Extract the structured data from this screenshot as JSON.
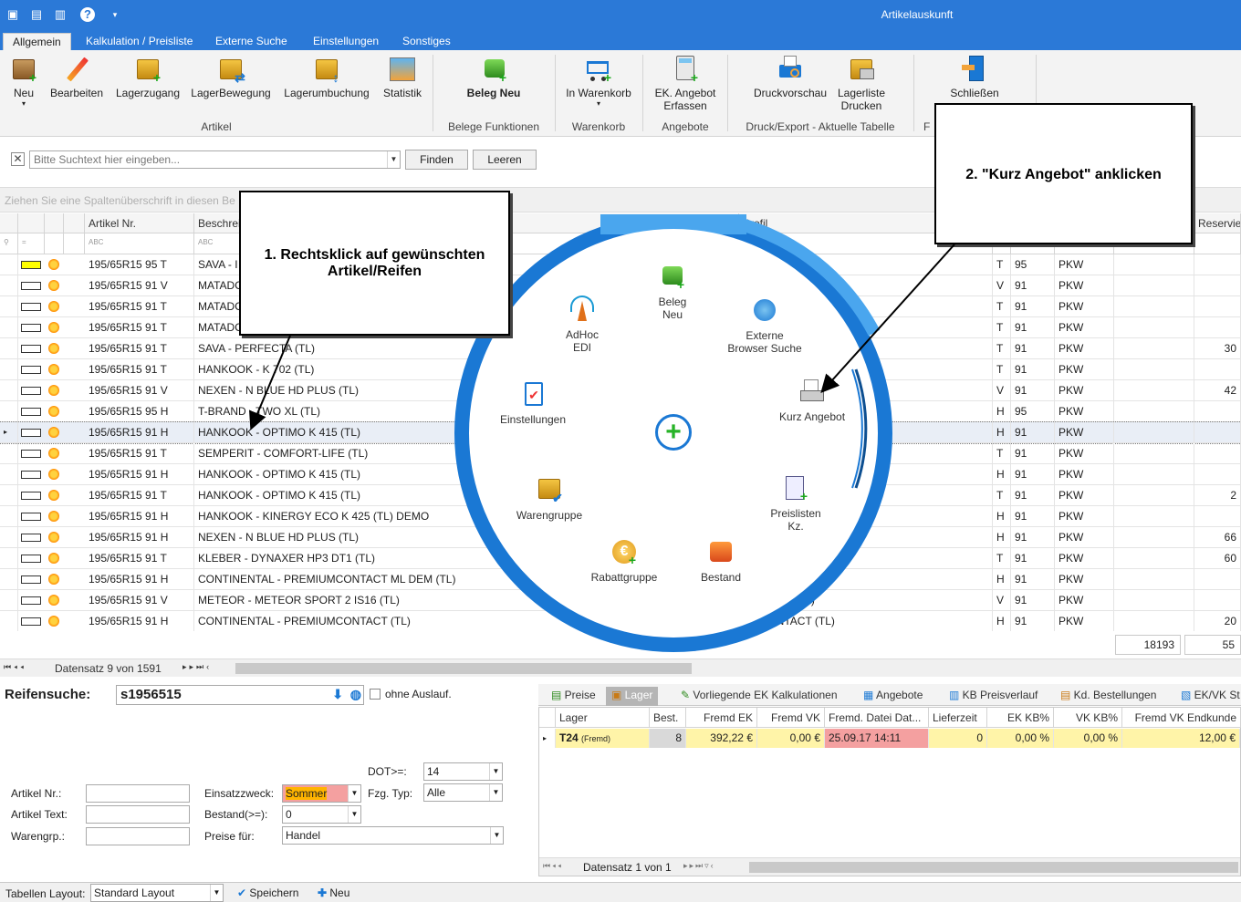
{
  "window": {
    "title": "Artikelauskunft"
  },
  "tabs": [
    "Allgemein",
    "Kalkulation / Preisliste",
    "Externe Suche",
    "Einstellungen",
    "Sonstiges"
  ],
  "ribbon": {
    "buttons": [
      "Neu",
      "Bearbeiten",
      "Lagerzugang",
      "LagerBewegung",
      "Lagerumbuchung",
      "Statistik",
      "Beleg Neu",
      "In Warenkorb",
      "EK. Angebot",
      "Erfassen",
      "Druckvorschau",
      "Lagerliste",
      "Drucken",
      "Schließen"
    ],
    "groups": [
      "Artikel",
      "Belege Funktionen",
      "Warenkorb",
      "Angebote",
      "Druck/Export - Aktuelle Tabelle",
      "F"
    ]
  },
  "search": {
    "placeholder": "Bitte Suchtext hier eingeben...",
    "find_label": "Finden",
    "clear_label": "Leeren"
  },
  "group_panel_text": "Ziehen Sie eine Spaltenüberschrift in diesen Be",
  "grid": {
    "columns": [
      "Artikel Nr.",
      "Beschrei",
      "Profil",
      "Reservier"
    ],
    "rows": [
      {
        "nr": "195/65R15 95 T",
        "desc": "SAVA - I",
        "profil": "(TL)",
        "si": "T",
        "li": "95",
        "typ": "PKW",
        "res": "",
        "yellow": true
      },
      {
        "nr": "195/65R15 91 V",
        "desc": "MATADO",
        "profil": "",
        "si": "V",
        "li": "91",
        "typ": "PKW",
        "res": ""
      },
      {
        "nr": "195/65R15 91 T",
        "desc": "MATADO",
        "profil": "",
        "si": "T",
        "li": "91",
        "typ": "PKW",
        "res": ""
      },
      {
        "nr": "195/65R15 91 T",
        "desc": "MATADO",
        "profil": "",
        "si": "T",
        "li": "91",
        "typ": "PKW",
        "res": ""
      },
      {
        "nr": "195/65R15 91 T",
        "desc": "SAVA - PERFECTA (TL)",
        "profil": "",
        "si": "T",
        "li": "91",
        "typ": "PKW",
        "res": "30"
      },
      {
        "nr": "195/65R15 91 T",
        "desc": "HANKOOK - K 702 (TL)",
        "profil": "",
        "si": "T",
        "li": "91",
        "typ": "PKW",
        "res": ""
      },
      {
        "nr": "195/65R15 91 V",
        "desc": "NEXEN - N BLUE HD PLUS (TL)",
        "profil": "",
        "si": "V",
        "li": "91",
        "typ": "PKW",
        "res": "42"
      },
      {
        "nr": "195/65R15 95 H",
        "desc": "T-BRAND - TWO XL (TL)",
        "profil": "",
        "si": "H",
        "li": "95",
        "typ": "PKW",
        "res": ""
      },
      {
        "nr": "195/65R15 91 H",
        "desc": "HANKOOK - OPTIMO K 415 (TL)",
        "profil": "",
        "si": "H",
        "li": "91",
        "typ": "PKW",
        "res": "",
        "selected": true
      },
      {
        "nr": "195/65R15 91 T",
        "desc": "SEMPERIT - COMFORT-LIFE (TL)",
        "profil": "",
        "si": "T",
        "li": "91",
        "typ": "PKW",
        "res": ""
      },
      {
        "nr": "195/65R15 91 H",
        "desc": "HANKOOK - OPTIMO K 415 (TL)",
        "profil": "",
        "si": "H",
        "li": "91",
        "typ": "PKW",
        "res": ""
      },
      {
        "nr": "195/65R15 91 T",
        "desc": "HANKOOK - OPTIMO K 415 (TL)",
        "profil": "",
        "si": "T",
        "li": "91",
        "typ": "PKW",
        "res": "2"
      },
      {
        "nr": "195/65R15 91 H",
        "desc": "HANKOOK - KINERGY ECO K 425 (TL) DEMO",
        "profil": "DEMO",
        "si": "H",
        "li": "91",
        "typ": "PKW",
        "res": ""
      },
      {
        "nr": "195/65R15 91 H",
        "desc": "NEXEN - N BLUE HD PLUS (TL)",
        "profil": "",
        "si": "H",
        "li": "91",
        "typ": "PKW",
        "res": "66"
      },
      {
        "nr": "195/65R15 91 T",
        "desc": "KLEBER - DYNAXER HP3 DT1 (TL)",
        "profil": "(TL)",
        "si": "T",
        "li": "91",
        "typ": "PKW",
        "res": "60"
      },
      {
        "nr": "195/65R15 91 H",
        "desc": "CONTINENTAL - PREMIUMCONTACT ML DEM (TL)",
        "profil": "T ML DEM (TL)",
        "si": "H",
        "li": "91",
        "typ": "PKW",
        "res": ""
      },
      {
        "nr": "195/65R15 91 V",
        "desc": "METEOR - METEOR SPORT 2 IS16 (TL)",
        "profil": "RT 2 IS16 (TL)",
        "si": "V",
        "li": "91",
        "typ": "PKW",
        "res": ""
      },
      {
        "nr": "195/65R15 91 H",
        "desc": "CONTINENTAL - PREMIUMCONTACT (TL)",
        "profil": "UMCONTACT (TL)",
        "si": "H",
        "li": "91",
        "typ": "PKW",
        "res": "20"
      }
    ],
    "sum1": "18193",
    "sum2": "55"
  },
  "navbar": {
    "text": "Datensatz 9 von 1591"
  },
  "radial_menu": {
    "items": [
      "Beleg Neu",
      "Externe Browser Suche",
      "Kurz Angebot",
      "Preislisten Kz.",
      "Bestand",
      "Rabattgruppe",
      "Warengruppe",
      "Einstellungen",
      "AdHoc EDI"
    ]
  },
  "callouts": {
    "step1": "1. Rechtsklick auf gewünschten Artikel/Reifen",
    "step2": "2. \"Kurz Angebot\" anklicken"
  },
  "reifensuche": {
    "label": "Reifensuche:",
    "value": "s1956515",
    "ohne_auslauf": "ohne Auslauf.",
    "dot_label": "DOT>=:",
    "dot_value": "14",
    "artikel_nr_label": "Artikel Nr.:",
    "artikel_text_label": "Artikel Text:",
    "warengrp_label": "Warengrp.:",
    "einsatzzweck_label": "Einsatzzweck:",
    "einsatzzweck_value": "Sommer",
    "bestand_label": "Bestand(>=):",
    "bestand_value": "0",
    "preise_label": "Preise für:",
    "preise_value": "Handel",
    "fzg_label": "Fzg. Typ:",
    "fzg_value": "Alle"
  },
  "detail_tabs": [
    "Preise",
    "Lager",
    "Vorliegende EK Kalkulationen",
    "Angebote",
    "KB Preisverlauf",
    "Kd. Bestellungen",
    "EK/VK St"
  ],
  "lager": {
    "columns": [
      "Lager",
      "Best.",
      "Fremd EK",
      "Fremd VK",
      "Fremd. Datei Dat...",
      "Lieferzeit",
      "EK KB%",
      "VK KB%",
      "Fremd VK Endkunde"
    ],
    "row": {
      "lager": "T24",
      "lager_sub": "(Fremd)",
      "best": "8",
      "fremd_ek": "392,22 €",
      "fremd_vk": "0,00 €",
      "datum": "25.09.17 14:11",
      "lieferzeit": "0",
      "ek_kb": "0,00 %",
      "vk_kb": "0,00 %",
      "endkunde": "12,00 €"
    },
    "nav": "Datensatz 1 von 1"
  },
  "statusbar": {
    "layout_label": "Tabellen Layout:",
    "layout_value": "Standard Layout",
    "save_label": "Speichern",
    "new_label": "Neu"
  }
}
